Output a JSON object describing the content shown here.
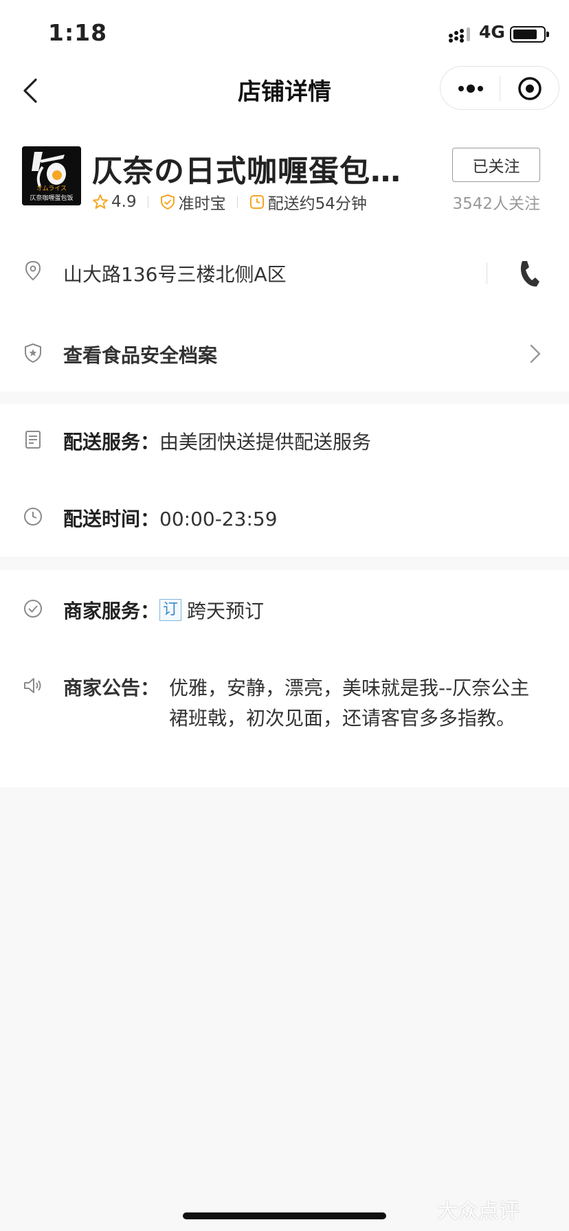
{
  "status_bar": {
    "time": "1:18",
    "network": "4G"
  },
  "nav": {
    "title": "店铺详情"
  },
  "shop": {
    "name": "仄奈の日式咖喱蛋包饭…",
    "logo_text": "オムライス",
    "logo_subtext": "仄奈咖喱蛋包饭",
    "rating": "4.9",
    "badge_ontime": "准时宝",
    "delivery_eta": "配送约54分钟",
    "follow_label": "已关注",
    "followers": "3542人关注"
  },
  "address": {
    "text": "山大路136号三楼北侧A区"
  },
  "food_safety": {
    "label": "查看食品安全档案"
  },
  "delivery_service": {
    "label": "配送服务：",
    "value": "由美团快送提供配送服务"
  },
  "delivery_time": {
    "label": "配送时间：",
    "value": "00:00-23:59"
  },
  "merchant_service": {
    "label": "商家服务：",
    "badge": "订",
    "value": "跨天预订"
  },
  "notice": {
    "label": "商家公告：",
    "value": "优雅，安静，漂亮，美味就是我--仄奈公主裙班戟，初次见面，还请客官多多指教。"
  },
  "watermark": "大众点评",
  "colors": {
    "accent_orange": "#f5a623",
    "badge_blue": "#3a8bc8",
    "icon_gray": "#8a8a8a"
  }
}
